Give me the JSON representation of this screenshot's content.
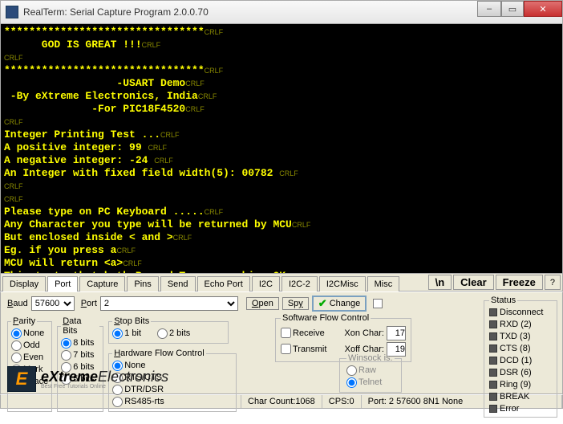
{
  "window": {
    "title": "RealTerm: Serial Capture Program 2.0.0.70"
  },
  "terminal": {
    "lines": [
      "********************************",
      "      GOD IS GREAT !!!",
      "",
      "********************************",
      "                  -USART Demo",
      " -By eXtreme Electronics, India",
      "              -For PIC18F4520",
      "",
      "Integer Printing Test ...",
      "A positive integer: 99 ",
      "A negative integer: -24 ",
      "An Integer with fixed field width(5): 00782 ",
      "",
      "",
      "Please type on PC Keyboard .....",
      "Any Character you type will be returned by MCU",
      "But enclosed inside < and >",
      "Eg. if you press a",
      "MCU will return <a>",
      "This tests that both Rx and Tx are working OK"
    ],
    "crlf": "CRLF"
  },
  "tabs": [
    "Display",
    "Port",
    "Capture",
    "Pins",
    "Send",
    "Echo Port",
    "I2C",
    "I2C-2",
    "I2CMisc",
    "Misc"
  ],
  "tab_active": 1,
  "rightbtns": {
    "newline": "\\n",
    "clear": "Clear",
    "freeze": "Freeze",
    "help": "?"
  },
  "port": {
    "baud_label": "Baud",
    "baud": "57600",
    "port_label": "Port",
    "port": "2",
    "open": "Open",
    "spy": "Spy",
    "change": "Change"
  },
  "parity": {
    "legend": "Parity",
    "opts": [
      "None",
      "Odd",
      "Even",
      "Mark",
      "Space"
    ],
    "sel": "None"
  },
  "databits": {
    "legend": "Data Bits",
    "opts": [
      "8 bits",
      "7 bits",
      "6 bits",
      "5 bits"
    ],
    "sel": "8 bits"
  },
  "stopbits": {
    "legend": "Stop Bits",
    "opts": [
      "1 bit",
      "2 bits"
    ],
    "sel": "1 bit"
  },
  "hwflow": {
    "legend": "Hardware Flow Control",
    "opts": [
      "None",
      "RTS/CTS",
      "DTR/DSR",
      "RS485-rts"
    ],
    "sel": "None"
  },
  "swflow": {
    "legend": "Software Flow Control",
    "receive": "Receive",
    "xon_label": "Xon Char:",
    "xon": "17",
    "transmit": "Transmit",
    "xoff_label": "Xoff Char:",
    "xoff": "19"
  },
  "winsock": {
    "legend": "Winsock is:",
    "opts": [
      "Raw",
      "Telnet"
    ],
    "sel": "Telnet"
  },
  "status": {
    "legend": "Status",
    "items": [
      "Disconnect",
      "RXD (2)",
      "TXD (3)",
      "CTS (8)",
      "DCD (1)",
      "DSR (6)",
      "Ring (9)",
      "BREAK",
      "Error"
    ]
  },
  "logo": {
    "brand1": "eXtreme",
    "brand2": "Electronics",
    "sub": "Best Free Tutorials Online"
  },
  "statusbar": {
    "charcount_label": "Char Count:",
    "charcount": "1068",
    "cps_label": "CPS:",
    "cps": "0",
    "portinfo": "Port: 2 57600 8N1 None"
  }
}
